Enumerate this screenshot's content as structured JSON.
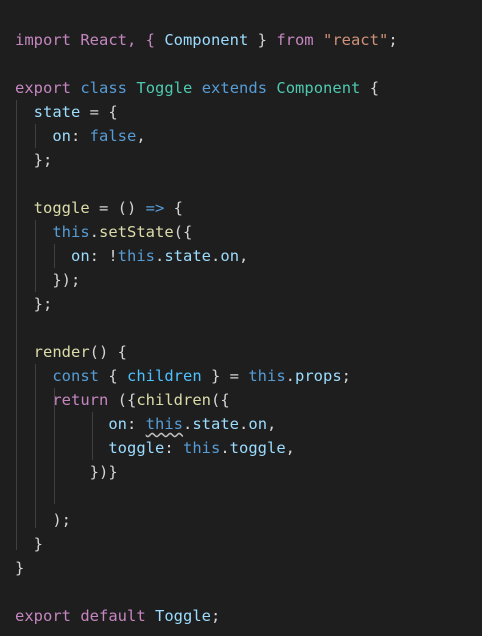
{
  "editor": {
    "lines": [
      [
        {
          "t": "import React, { ",
          "c": "ctl"
        },
        {
          "t": "Component",
          "c": "var"
        },
        {
          "t": " } ",
          "c": "plain"
        },
        {
          "t": "from",
          "c": "ctl"
        },
        {
          "t": " ",
          "c": "plain"
        },
        {
          "t": "\"react\"",
          "c": "str"
        },
        {
          "t": ";",
          "c": "plain"
        }
      ],
      [],
      [
        {
          "t": "export",
          "c": "ctl"
        },
        {
          "t": " ",
          "c": "plain"
        },
        {
          "t": "class",
          "c": "kw"
        },
        {
          "t": " ",
          "c": "plain"
        },
        {
          "t": "Toggle",
          "c": "cls"
        },
        {
          "t": " ",
          "c": "plain"
        },
        {
          "t": "extends",
          "c": "kw"
        },
        {
          "t": " ",
          "c": "plain"
        },
        {
          "t": "Component",
          "c": "cls"
        },
        {
          "t": " {",
          "c": "plain"
        }
      ],
      [
        {
          "t": "  ",
          "c": "plain"
        },
        {
          "t": "state",
          "c": "var"
        },
        {
          "t": " = {",
          "c": "plain"
        }
      ],
      [
        {
          "t": "    ",
          "c": "plain"
        },
        {
          "t": "on",
          "c": "var"
        },
        {
          "t": ": ",
          "c": "plain"
        },
        {
          "t": "false",
          "c": "kw"
        },
        {
          "t": ",",
          "c": "plain"
        }
      ],
      [
        {
          "t": "  };",
          "c": "plain"
        }
      ],
      [],
      [
        {
          "t": "  ",
          "c": "plain"
        },
        {
          "t": "toggle",
          "c": "fn"
        },
        {
          "t": " = () ",
          "c": "plain"
        },
        {
          "t": "=>",
          "c": "kw"
        },
        {
          "t": " {",
          "c": "plain"
        }
      ],
      [
        {
          "t": "    ",
          "c": "plain"
        },
        {
          "t": "this",
          "c": "kw"
        },
        {
          "t": ".",
          "c": "plain"
        },
        {
          "t": "setState",
          "c": "fn"
        },
        {
          "t": "({",
          "c": "plain"
        }
      ],
      [
        {
          "t": "      ",
          "c": "plain"
        },
        {
          "t": "on",
          "c": "var"
        },
        {
          "t": ": !",
          "c": "plain"
        },
        {
          "t": "this",
          "c": "kw"
        },
        {
          "t": ".",
          "c": "plain"
        },
        {
          "t": "state",
          "c": "var"
        },
        {
          "t": ".",
          "c": "plain"
        },
        {
          "t": "on",
          "c": "var"
        },
        {
          "t": ",",
          "c": "plain"
        }
      ],
      [
        {
          "t": "    });",
          "c": "plain"
        }
      ],
      [
        {
          "t": "  };",
          "c": "plain"
        }
      ],
      [],
      [
        {
          "t": "  ",
          "c": "plain"
        },
        {
          "t": "render",
          "c": "fn"
        },
        {
          "t": "() {",
          "c": "plain"
        }
      ],
      [
        {
          "t": "    ",
          "c": "plain"
        },
        {
          "t": "const",
          "c": "kw"
        },
        {
          "t": " { ",
          "c": "plain"
        },
        {
          "t": "children",
          "c": "var2"
        },
        {
          "t": " } = ",
          "c": "plain"
        },
        {
          "t": "this",
          "c": "kw"
        },
        {
          "t": ".",
          "c": "plain"
        },
        {
          "t": "props",
          "c": "var"
        },
        {
          "t": ";",
          "c": "plain"
        }
      ],
      [
        {
          "t": "    ",
          "c": "plain"
        },
        {
          "t": "return",
          "c": "ctl"
        },
        {
          "t": " ({",
          "c": "plain"
        },
        {
          "t": "children",
          "c": "fn"
        },
        {
          "t": "({",
          "c": "plain"
        }
      ],
      [
        {
          "t": "          ",
          "c": "plain"
        },
        {
          "t": "on",
          "c": "var"
        },
        {
          "t": ": ",
          "c": "plain"
        },
        {
          "t": "this",
          "c": "kw",
          "s": true
        },
        {
          "t": ".",
          "c": "plain"
        },
        {
          "t": "state",
          "c": "var"
        },
        {
          "t": ".",
          "c": "plain"
        },
        {
          "t": "on",
          "c": "var"
        },
        {
          "t": ",",
          "c": "plain"
        }
      ],
      [
        {
          "t": "          ",
          "c": "plain"
        },
        {
          "t": "toggle",
          "c": "var"
        },
        {
          "t": ": ",
          "c": "plain"
        },
        {
          "t": "this",
          "c": "kw"
        },
        {
          "t": ".",
          "c": "plain"
        },
        {
          "t": "toggle",
          "c": "var"
        },
        {
          "t": ",",
          "c": "plain"
        }
      ],
      [
        {
          "t": "        })}",
          "c": "plain"
        }
      ],
      [],
      [
        {
          "t": "    );",
          "c": "plain"
        }
      ],
      [
        {
          "t": "  }",
          "c": "plain"
        }
      ],
      [
        {
          "t": "}",
          "c": "plain"
        }
      ],
      [],
      [
        {
          "t": "export",
          "c": "ctl"
        },
        {
          "t": " ",
          "c": "plain"
        },
        {
          "t": "default",
          "c": "ctl"
        },
        {
          "t": " ",
          "c": "plain"
        },
        {
          "t": "Toggle",
          "c": "var"
        },
        {
          "t": ";",
          "c": "plain"
        }
      ]
    ]
  },
  "colors": {
    "background": "#1e1e1e",
    "plain": "#d4d4d4",
    "keyword": "#569cd6",
    "control": "#c586c0",
    "string": "#ce9178",
    "variable": "#9cdcfe",
    "function": "#dcdcaa",
    "class": "#4ec9b0",
    "constant": "#4fc1ff"
  }
}
